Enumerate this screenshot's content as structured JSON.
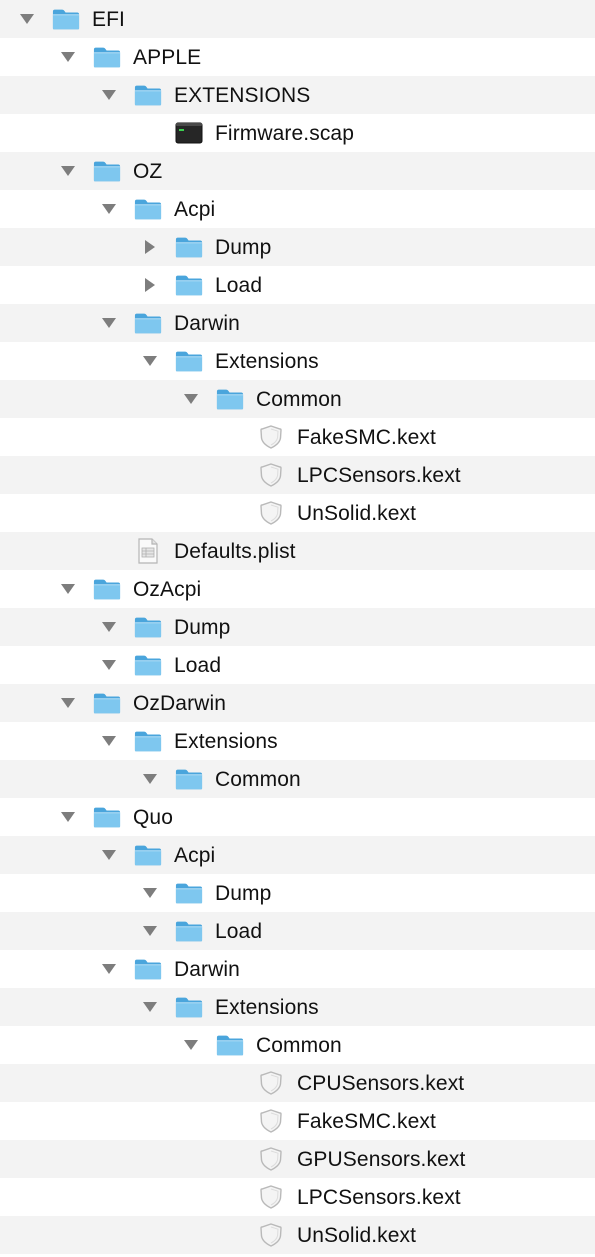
{
  "colors": {
    "row_alt": "#f3f3f3",
    "row_plain": "#ffffff",
    "folder_light": "#7ec7ef",
    "folder_dark": "#4aa5dc",
    "disclosure": "#7d7d7d",
    "text": "#111111"
  },
  "tree": [
    {
      "label": "EFI",
      "depth": 0,
      "kind": "folder",
      "icon": "folder-icon",
      "state": "expanded"
    },
    {
      "label": "APPLE",
      "depth": 1,
      "kind": "folder",
      "icon": "folder-icon",
      "state": "expanded"
    },
    {
      "label": "EXTENSIONS",
      "depth": 2,
      "kind": "folder",
      "icon": "folder-icon",
      "state": "expanded"
    },
    {
      "label": "Firmware.scap",
      "depth": 3,
      "kind": "file",
      "icon": "executable-file-icon",
      "state": "none"
    },
    {
      "label": "OZ",
      "depth": 1,
      "kind": "folder",
      "icon": "folder-icon",
      "state": "expanded"
    },
    {
      "label": "Acpi",
      "depth": 2,
      "kind": "folder",
      "icon": "folder-icon",
      "state": "expanded"
    },
    {
      "label": "Dump",
      "depth": 3,
      "kind": "folder",
      "icon": "folder-icon",
      "state": "collapsed"
    },
    {
      "label": "Load",
      "depth": 3,
      "kind": "folder",
      "icon": "folder-icon",
      "state": "collapsed"
    },
    {
      "label": "Darwin",
      "depth": 2,
      "kind": "folder",
      "icon": "folder-icon",
      "state": "expanded"
    },
    {
      "label": "Extensions",
      "depth": 3,
      "kind": "folder",
      "icon": "folder-icon",
      "state": "expanded"
    },
    {
      "label": "Common",
      "depth": 4,
      "kind": "folder",
      "icon": "folder-icon",
      "state": "expanded"
    },
    {
      "label": "FakeSMC.kext",
      "depth": 5,
      "kind": "kext",
      "icon": "kext-shield-icon",
      "state": "none"
    },
    {
      "label": "LPCSensors.kext",
      "depth": 5,
      "kind": "kext",
      "icon": "kext-shield-icon",
      "state": "none"
    },
    {
      "label": "UnSolid.kext",
      "depth": 5,
      "kind": "kext",
      "icon": "kext-shield-icon",
      "state": "none"
    },
    {
      "label": "Defaults.plist",
      "depth": 2,
      "kind": "file",
      "icon": "plist-file-icon",
      "state": "none"
    },
    {
      "label": "OzAcpi",
      "depth": 1,
      "kind": "folder",
      "icon": "folder-icon",
      "state": "expanded"
    },
    {
      "label": "Dump",
      "depth": 2,
      "kind": "folder",
      "icon": "folder-icon",
      "state": "expanded"
    },
    {
      "label": "Load",
      "depth": 2,
      "kind": "folder",
      "icon": "folder-icon",
      "state": "expanded"
    },
    {
      "label": "OzDarwin",
      "depth": 1,
      "kind": "folder",
      "icon": "folder-icon",
      "state": "expanded"
    },
    {
      "label": "Extensions",
      "depth": 2,
      "kind": "folder",
      "icon": "folder-icon",
      "state": "expanded"
    },
    {
      "label": "Common",
      "depth": 3,
      "kind": "folder",
      "icon": "folder-icon",
      "state": "expanded"
    },
    {
      "label": "Quo",
      "depth": 1,
      "kind": "folder",
      "icon": "folder-icon",
      "state": "expanded"
    },
    {
      "label": "Acpi",
      "depth": 2,
      "kind": "folder",
      "icon": "folder-icon",
      "state": "expanded"
    },
    {
      "label": "Dump",
      "depth": 3,
      "kind": "folder",
      "icon": "folder-icon",
      "state": "expanded"
    },
    {
      "label": "Load",
      "depth": 3,
      "kind": "folder",
      "icon": "folder-icon",
      "state": "expanded"
    },
    {
      "label": "Darwin",
      "depth": 2,
      "kind": "folder",
      "icon": "folder-icon",
      "state": "expanded"
    },
    {
      "label": "Extensions",
      "depth": 3,
      "kind": "folder",
      "icon": "folder-icon",
      "state": "expanded"
    },
    {
      "label": "Common",
      "depth": 4,
      "kind": "folder",
      "icon": "folder-icon",
      "state": "expanded"
    },
    {
      "label": "CPUSensors.kext",
      "depth": 5,
      "kind": "kext",
      "icon": "kext-shield-icon",
      "state": "none"
    },
    {
      "label": "FakeSMC.kext",
      "depth": 5,
      "kind": "kext",
      "icon": "kext-shield-icon",
      "state": "none"
    },
    {
      "label": "GPUSensors.kext",
      "depth": 5,
      "kind": "kext",
      "icon": "kext-shield-icon",
      "state": "none"
    },
    {
      "label": "LPCSensors.kext",
      "depth": 5,
      "kind": "kext",
      "icon": "kext-shield-icon",
      "state": "none"
    },
    {
      "label": "UnSolid.kext",
      "depth": 5,
      "kind": "kext",
      "icon": "kext-shield-icon",
      "state": "none"
    }
  ]
}
